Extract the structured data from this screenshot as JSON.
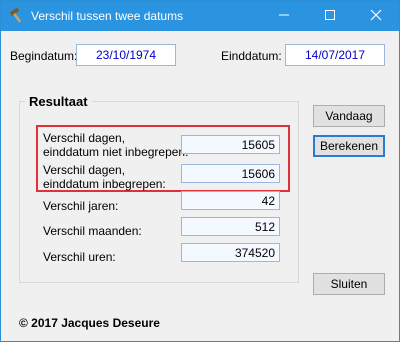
{
  "window": {
    "title": "Verschil tussen twee datums"
  },
  "inputs": {
    "begin_label": "Begindatum:",
    "begin_value": "23/10/1974",
    "end_label": "Einddatum:",
    "end_value": "14/07/2017"
  },
  "result": {
    "group_title": "Resultaat",
    "days_excl_label_1": "Verschil dagen,",
    "days_excl_label_2": "einddatum niet inbegrepen:",
    "days_excl_value": "15605",
    "days_incl_label_1": "Verschil dagen,",
    "days_incl_label_2": "einddatum inbegrepen:",
    "days_incl_value": "15606",
    "years_label": "Verschil jaren:",
    "years_value": "42",
    "months_label": "Verschil maanden:",
    "months_value": "512",
    "hours_label": "Verschil uren:",
    "hours_value": "374520"
  },
  "buttons": {
    "today": "Vandaag",
    "calculate": "Berekenen",
    "close": "Sluiten"
  },
  "footer": {
    "copyright": "© 2017 Jacques Deseure"
  },
  "colors": {
    "titlebar": "#2b94e1",
    "date_text": "#0000c8",
    "highlight": "#e0313a"
  },
  "icons": {
    "app": "hammer-icon",
    "minimize": "minimize-icon",
    "maximize": "maximize-icon",
    "close": "close-icon"
  }
}
